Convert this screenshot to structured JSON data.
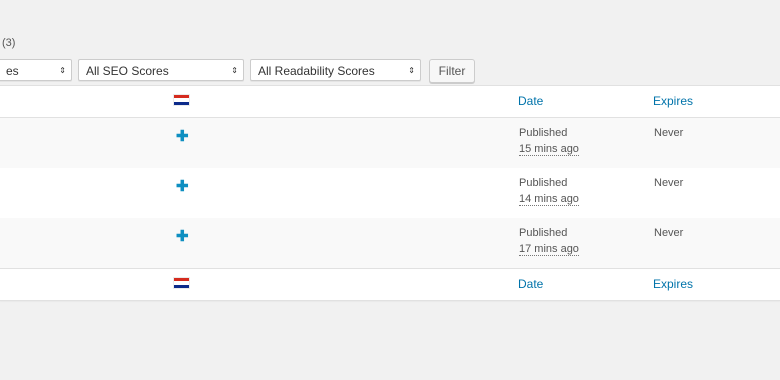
{
  "count_text": "(3)",
  "filters": {
    "first_select_partial": "es",
    "seo_select": "All SEO Scores",
    "readability_select": "All Readability Scores",
    "filter_button": "Filter"
  },
  "columns": {
    "date": "Date",
    "expires": "Expires"
  },
  "rows": [
    {
      "status": "Published",
      "ago": "15 mins ago",
      "expires": "Never"
    },
    {
      "status": "Published",
      "ago": "14 mins ago",
      "expires": "Never"
    },
    {
      "status": "Published",
      "ago": "17 mins ago",
      "expires": "Never"
    }
  ],
  "icons": {
    "flag": "croatia-flag-icon",
    "add": "plus-icon",
    "select_arrows": "updown-arrow-icon"
  },
  "colors": {
    "link": "#0073aa",
    "plus": "#0e8fc1",
    "background": "#f1f1f1"
  }
}
